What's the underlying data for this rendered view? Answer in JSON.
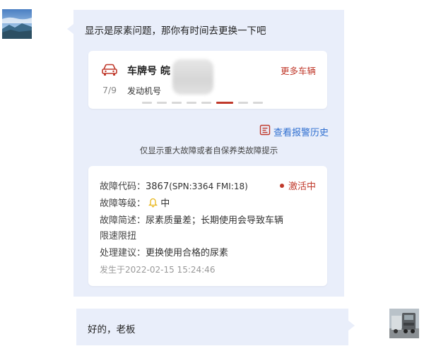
{
  "messages": {
    "incoming_text": "显示是尿素问题，那你有时间去更换一下吧",
    "reply_text": "好的，老板"
  },
  "vehicle": {
    "plate_label": "车牌号 皖",
    "more_vehicles_link": "更多车辆",
    "page_indicator": "7/9",
    "engine_label": "发动机号",
    "pager": {
      "count": 8,
      "active_index": 5
    }
  },
  "alerts": {
    "history_link": "查看报警历史",
    "notice": "仅显示重大故障或者自保养类故障提示"
  },
  "fault": {
    "code_label": "故障代码：",
    "code_value": "3867",
    "code_detail": "(SPN:3364 FMI:18)",
    "status": "激活中",
    "level_label": "故障等级：",
    "level_value": "中",
    "desc_label": "故障简述：",
    "desc_value_line1": "尿素质量差；长期使用会导致车辆",
    "desc_value_line2": "限速限扭",
    "advice_label": "处理建议：",
    "advice_value": "更换使用合格的尿素",
    "occurred_at": "发生于2022-02-15 15:24:46"
  },
  "colors": {
    "bubble_bg": "#e9eefa",
    "accent_red": "#c0392b",
    "link_blue": "#2f6fd0",
    "bell_yellow": "#e8b517"
  },
  "icons": {
    "car": "car-icon",
    "report": "report-icon",
    "bell": "bell-icon"
  }
}
